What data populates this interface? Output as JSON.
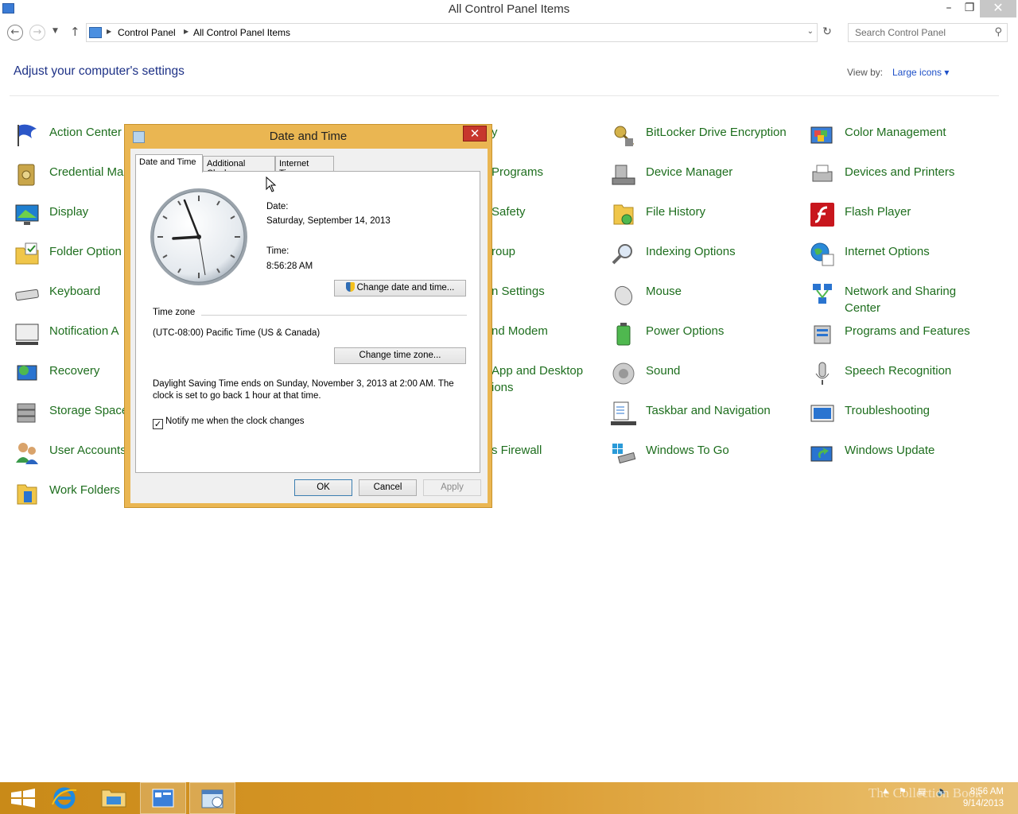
{
  "window": {
    "title": "All Control Panel Items"
  },
  "address": {
    "crumbs": [
      "Control Panel",
      "All Control Panel Items"
    ]
  },
  "search": {
    "placeholder": "Search Control Panel"
  },
  "header": {
    "title": "Adjust your computer's settings",
    "view_by_label": "View by:",
    "view_by_value": "Large icons"
  },
  "items": {
    "action_center": "Action Center",
    "credential": "Credential Ma",
    "display": "Display",
    "folder_options": "Folder Option",
    "keyboard": "Keyboard",
    "notification": "Notification A",
    "recovery": "Recovery",
    "storage": "Storage Space",
    "user_accounts": "User Accounts",
    "work_folders": "Work Folders",
    "c3_1": "y",
    "c3_2": "Programs",
    "c3_3": "Safety",
    "c3_4": "roup",
    "c3_5": "n Settings",
    "c3_6": "nd Modem",
    "c3_7a": "App and Desktop",
    "c3_7b": "ions",
    "c3_9": "s Firewall",
    "bitlocker": "BitLocker Drive Encryption",
    "device_manager": "Device Manager",
    "file_history": "File History",
    "indexing": "Indexing Options",
    "mouse": "Mouse",
    "power": "Power Options",
    "sound": "Sound",
    "taskbar_nav": "Taskbar and Navigation",
    "windows_to_go": "Windows To Go",
    "color_mgmt": "Color Management",
    "devices_printers": "Devices and Printers",
    "flash": "Flash Player",
    "internet_options": "Internet Options",
    "network_a": "Network and Sharing",
    "network_b": "Center",
    "programs_features": "Programs and Features",
    "speech": "Speech Recognition",
    "troubleshooting": "Troubleshooting",
    "windows_update": "Windows Update"
  },
  "dialog": {
    "title": "Date and Time",
    "tabs": [
      "Date and Time",
      "Additional Clocks",
      "Internet Time"
    ],
    "date_label": "Date:",
    "date_value": "Saturday, September 14, 2013",
    "time_label": "Time:",
    "time_value": "8:56:28 AM",
    "change_datetime": "Change date and time...",
    "timezone_header": "Time zone",
    "timezone_value": "(UTC-08:00) Pacific Time (US & Canada)",
    "change_timezone": "Change time zone...",
    "dst_line1": "Daylight Saving Time ends on Sunday, November 3, 2013 at 2:00 AM. The",
    "dst_line2": "clock is set to go back 1 hour at that time.",
    "notify_label": "Notify me when the clock changes",
    "ok": "OK",
    "cancel": "Cancel",
    "apply": "Apply"
  },
  "taskbar": {
    "time": "8:56 AM",
    "date": "9/14/2013",
    "watermark": "The Collection Book"
  },
  "colors": {
    "accent_link": "#1e6e1e",
    "title_blue": "#1e3287",
    "dialog_frame": "#eab652",
    "taskbar": "#d9982a"
  }
}
